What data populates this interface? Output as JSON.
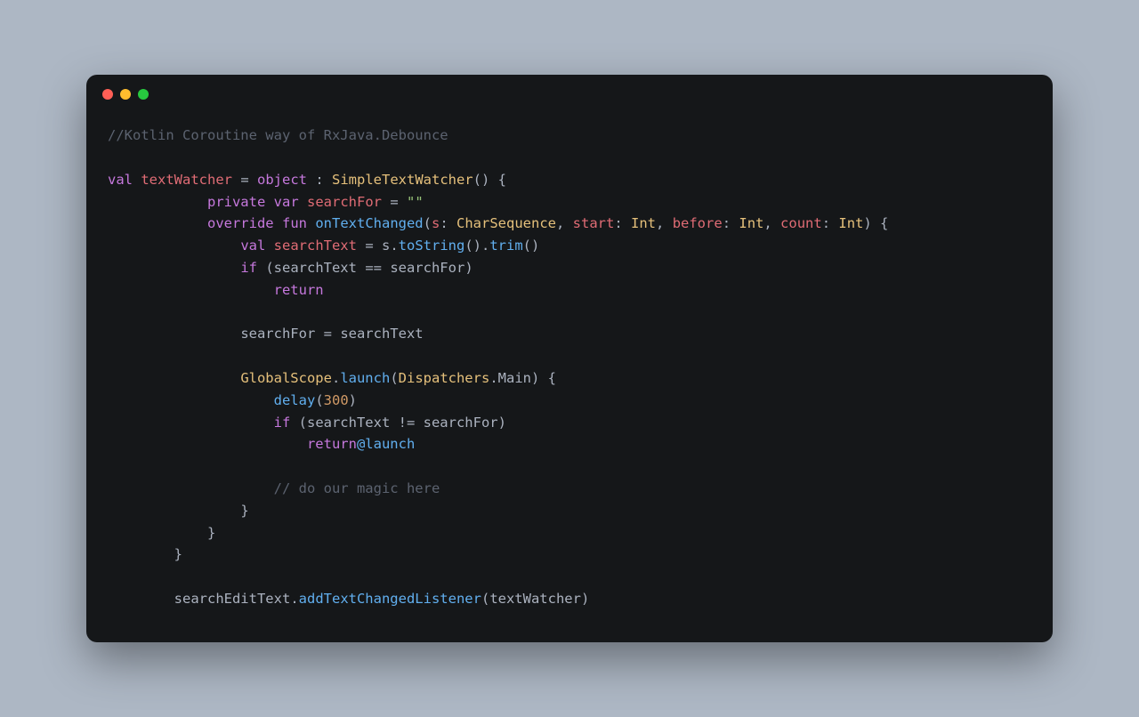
{
  "window": {
    "dots": [
      "red",
      "yellow",
      "green"
    ]
  },
  "code": {
    "l1_comment": "//Kotlin Coroutine way of RxJava.Debounce",
    "l3_val": "val",
    "l3_name": "textWatcher",
    "l3_eq": " = ",
    "l3_object": "object",
    "l3_colon": " : ",
    "l3_type": "SimpleTextWatcher",
    "l3_paren": "() {",
    "l4_private": "private",
    "l4_var": "var",
    "l4_name": "searchFor",
    "l4_eq": " = ",
    "l4_str": "\"\"",
    "l5_override": "override",
    "l5_fun": "fun",
    "l5_name": "onTextChanged",
    "l5_open": "(",
    "l5_p1": "s",
    "l5_p1t": "CharSequence",
    "l5_p2": "start",
    "l5_p2t": "Int",
    "l5_p3": "before",
    "l5_p3t": "Int",
    "l5_p4": "count",
    "l5_p4t": "Int",
    "l5_close": ") {",
    "l6_val": "val",
    "l6_name": "searchText",
    "l6_eq": " = ",
    "l6_s": "s",
    "l6_call1": "toString",
    "l6_call2": "trim",
    "l7_if": "if",
    "l7_open": " (",
    "l7_a": "searchText",
    "l7_op": " == ",
    "l7_b": "searchFor",
    "l7_close": ")",
    "l8_return": "return",
    "l10_a": "searchFor",
    "l10_eq": " = ",
    "l10_b": "searchText",
    "l12_scope": "GlobalScope",
    "l12_dot": ".",
    "l12_launch": "launch",
    "l12_open": "(",
    "l12_disp": "Dispatchers",
    "l12_main": "Main",
    "l12_close": ") {",
    "l13_delay": "delay",
    "l13_open": "(",
    "l13_num": "300",
    "l13_close": ")",
    "l14_if": "if",
    "l14_open": " (",
    "l14_a": "searchText",
    "l14_op": " != ",
    "l14_b": "searchFor",
    "l14_close": ")",
    "l15_return": "return",
    "l15_at": "@launch",
    "l17_comment": "// do our magic here",
    "l18_brace": "}",
    "l19_brace": "}",
    "l20_brace": "}",
    "l22_obj": "searchEditText",
    "l22_dot": ".",
    "l22_call": "addTextChangedListener",
    "l22_open": "(",
    "l22_arg": "textWatcher",
    "l22_close": ")"
  }
}
